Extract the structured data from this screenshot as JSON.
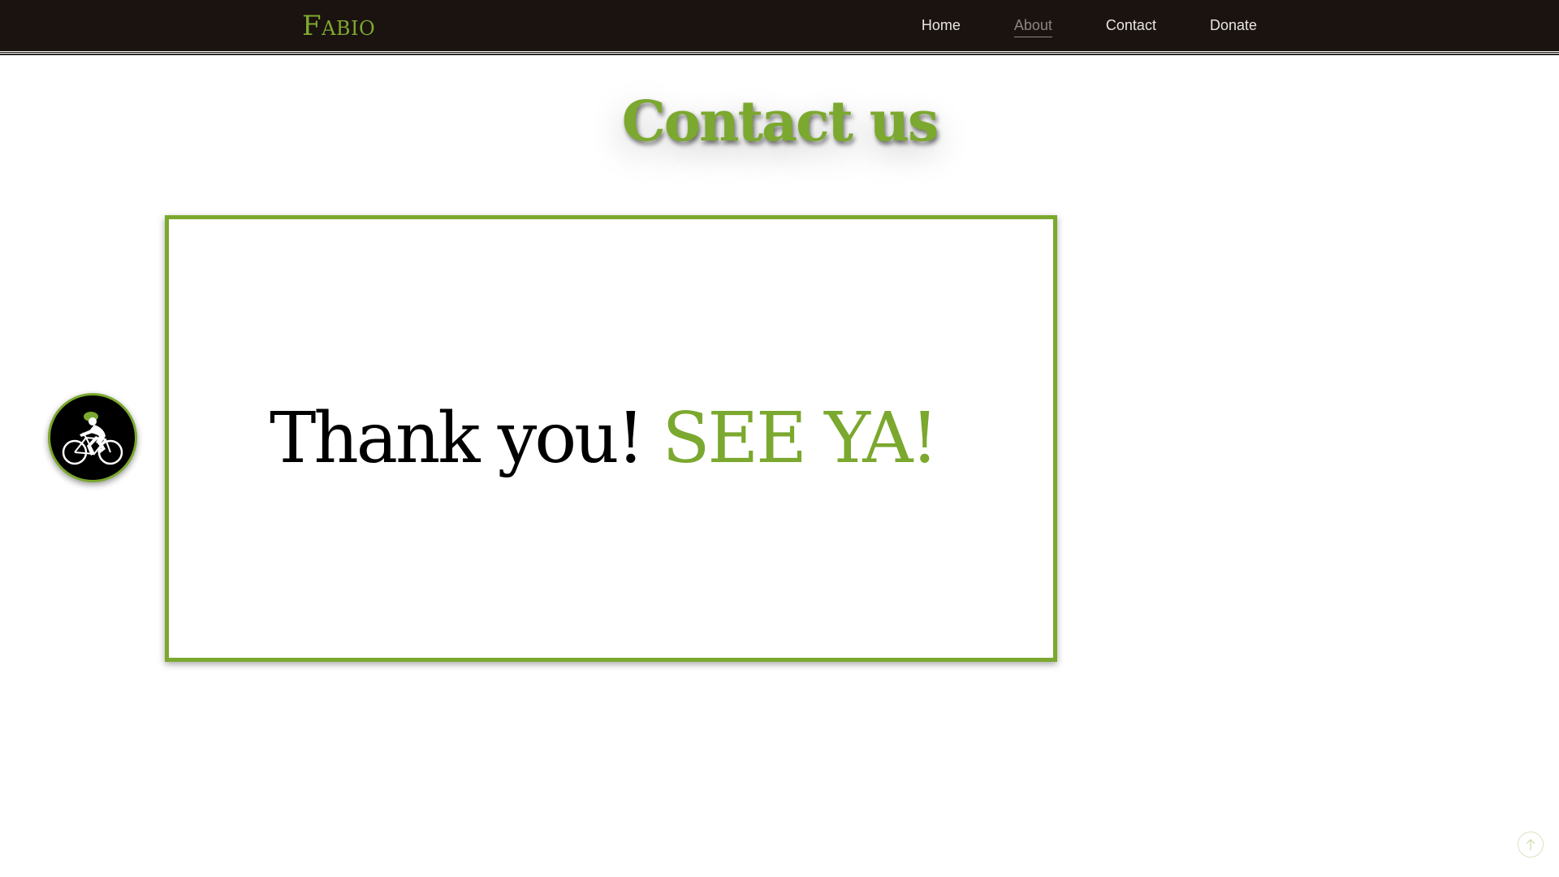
{
  "brand": {
    "name": "Fabio"
  },
  "nav": {
    "items": [
      {
        "label": "Home"
      },
      {
        "label": "About"
      },
      {
        "label": "Contact"
      },
      {
        "label": "Donate"
      }
    ],
    "active": "About"
  },
  "main": {
    "title": "Contact us",
    "message_main": "Thank you!",
    "message_accent": "SEE YA!"
  },
  "icons": {
    "avatar": "cyclist-icon",
    "scroll_top": "arrow-up-icon"
  },
  "colors": {
    "nav_background": "#1b130f",
    "accent_green": "#7ba82e",
    "text_dark": "#000000"
  }
}
